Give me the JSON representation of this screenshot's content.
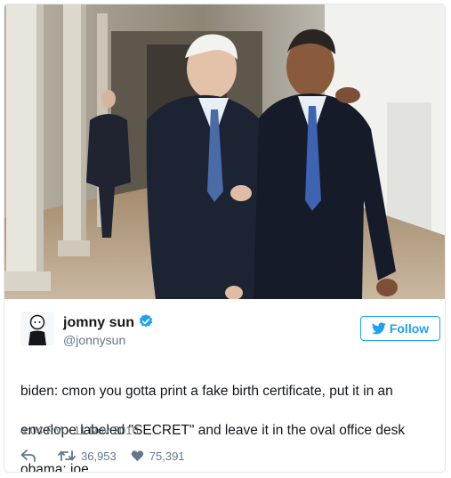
{
  "author": {
    "display_name": "jomny sun",
    "handle": "@jonnysun",
    "verified": true
  },
  "follow_button": {
    "label": "Follow"
  },
  "tweet": {
    "text_lines": [
      "biden: cmon you gotta print a fake birth certificate, put it in an",
      "envelope labeled \"SECRET\" and leave it in the oval office desk",
      "obama: joe"
    ],
    "timestamp": "4:04 PM - 11 Nov 2016"
  },
  "stats": {
    "retweets": "36,953",
    "likes": "75,391"
  },
  "icons": {
    "verified": "verified-badge-icon",
    "follow": "twitter-bird-icon",
    "reply": "reply-arrow-icon",
    "retweet": "retweet-icon",
    "like": "heart-icon"
  },
  "colors": {
    "accent": "#1da1f2",
    "text": "#14171a",
    "secondary_text": "#657786",
    "border": "#e1e8ed"
  }
}
